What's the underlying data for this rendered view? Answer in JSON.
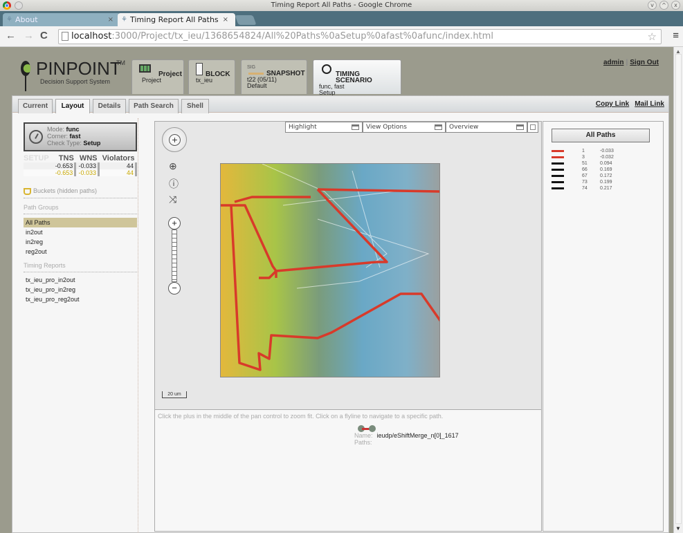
{
  "window": {
    "title": "Timing Report All Paths - Google Chrome",
    "tabs": [
      {
        "label": "About",
        "active": false
      },
      {
        "label": "Timing Report All Paths",
        "active": true
      }
    ],
    "url_host": "localhost",
    "url_path": ":3000/Project/tx_ieu/1368654824/All%20Paths%0aSetup%0afast%0afunc/index.html"
  },
  "header": {
    "logo_name": "PINPOINT",
    "logo_tm": "TM",
    "logo_sub": "Decision Support System",
    "context": {
      "project": {
        "title": "Project",
        "line1": "Project"
      },
      "block": {
        "title": "BLOCK",
        "line1": "tx_ieu"
      },
      "snapshot": {
        "tag": "SIG",
        "title": "SNAPSHOT",
        "line1": "t22 (05/11)",
        "line2": "Default"
      },
      "timing": {
        "title": "TIMING SCENARIO",
        "line1": "func, fast",
        "line2": "Setup"
      }
    },
    "user": "admin",
    "sign_out": "Sign Out"
  },
  "subtabs": [
    {
      "label": "Current",
      "active": false
    },
    {
      "label": "Layout",
      "active": true
    },
    {
      "label": "Details",
      "active": false
    },
    {
      "label": "Path Search",
      "active": false
    },
    {
      "label": "Shell",
      "active": false
    }
  ],
  "links": {
    "copy": "Copy Link",
    "mail": "Mail Link"
  },
  "sidebar": {
    "mode_label": "Mode:",
    "mode": "func",
    "corner_label": "Corner:",
    "corner": "fast",
    "check_label": "Check Type:",
    "check": "Setup",
    "stats": {
      "headers": [
        "SETUP",
        "TNS",
        "WNS",
        "Violators"
      ],
      "rows": [
        [
          "",
          "-0.653",
          "-0.033",
          "44"
        ],
        [
          "",
          "-0.653",
          "-0.033",
          "44"
        ]
      ]
    },
    "buckets": "Buckets (hidden paths)",
    "path_groups_title": "Path Groups",
    "path_groups": [
      "All Paths",
      "in2out",
      "in2reg",
      "reg2out"
    ],
    "selected_group": "All Paths",
    "timing_reports_title": "Timing Reports",
    "timing_reports": [
      "tx_ieu_pro_in2out",
      "tx_ieu_pro_in2reg",
      "tx_ieu_pro_reg2out"
    ]
  },
  "map": {
    "toolbar": [
      "Highlight",
      "View Options",
      "Overview"
    ],
    "scale": "20 um",
    "hint": "Click the plus in the middle of the pan control to zoom fit. Click on a flyline to navigate to a specific path.",
    "name_label": "Name:",
    "name_value": "ieudp/eShiftMerge_n[0]_1617",
    "paths_label": "Paths:"
  },
  "paths_panel": {
    "title": "All Paths",
    "rows": [
      {
        "id": "1",
        "slack": "-0.033",
        "color": "#d83a2a"
      },
      {
        "id": "3",
        "slack": "-0.032",
        "color": "#d83a2a"
      },
      {
        "id": "51",
        "slack": "0.094",
        "color": "#111111"
      },
      {
        "id": "66",
        "slack": "0.169",
        "color": "#111111"
      },
      {
        "id": "67",
        "slack": "0.172",
        "color": "#111111"
      },
      {
        "id": "73",
        "slack": "0.199",
        "color": "#111111"
      },
      {
        "id": "74",
        "slack": "0.217",
        "color": "#111111"
      }
    ]
  }
}
